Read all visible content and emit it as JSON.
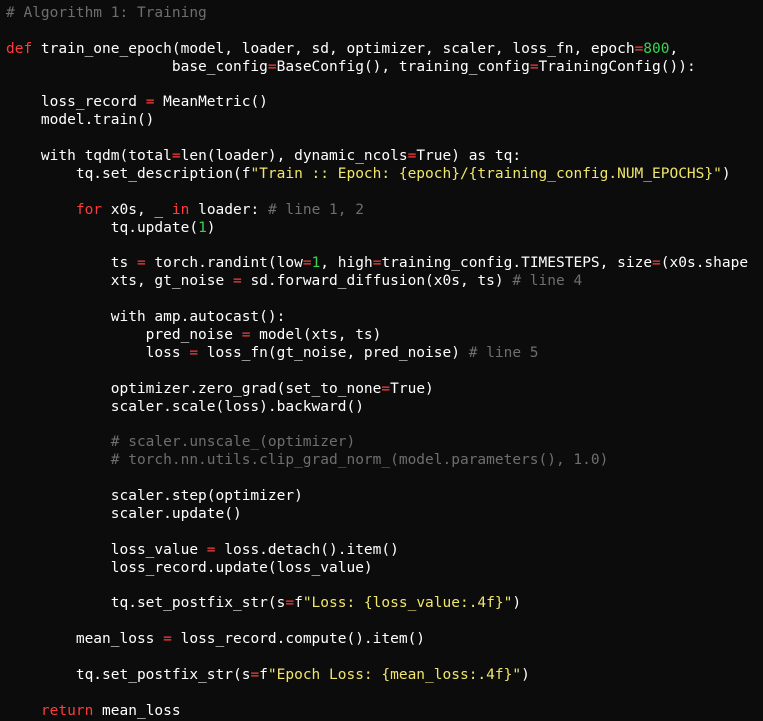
{
  "colors": {
    "background": "#0c0c0c",
    "text": "#ffffff",
    "comment": "#6e6e6e",
    "keyword": "#ff3b3b",
    "number": "#39d353",
    "string": "#f0e66b"
  },
  "code": {
    "lines": [
      [
        {
          "t": "# Algorithm 1: Training",
          "c": "comment"
        }
      ],
      [],
      [
        {
          "t": "def",
          "c": "kw"
        },
        {
          "t": " train_one_epoch(model, loader, sd, optimizer, scaler, loss_fn, epoch",
          "c": "ident"
        },
        {
          "t": "=",
          "c": "op"
        },
        {
          "t": "800",
          "c": "num"
        },
        {
          "t": ",",
          "c": "ident"
        }
      ],
      [
        {
          "t": "                   base_config",
          "c": "ident"
        },
        {
          "t": "=",
          "c": "op"
        },
        {
          "t": "BaseConfig(), training_config",
          "c": "ident"
        },
        {
          "t": "=",
          "c": "op"
        },
        {
          "t": "TrainingConfig()):",
          "c": "ident"
        }
      ],
      [],
      [
        {
          "t": "    loss_record ",
          "c": "ident"
        },
        {
          "t": "=",
          "c": "op"
        },
        {
          "t": " MeanMetric()",
          "c": "ident"
        }
      ],
      [
        {
          "t": "    model.train()",
          "c": "ident"
        }
      ],
      [],
      [
        {
          "t": "    with tqdm(total",
          "c": "ident"
        },
        {
          "t": "=",
          "c": "op"
        },
        {
          "t": "len(loader), dynamic_ncols",
          "c": "ident"
        },
        {
          "t": "=",
          "c": "op"
        },
        {
          "t": "True) as tq:",
          "c": "ident"
        }
      ],
      [
        {
          "t": "        tq.set_description(f",
          "c": "ident"
        },
        {
          "t": "\"Train :: Epoch: {epoch}/{training_config.NUM_EPOCHS}\"",
          "c": "str"
        },
        {
          "t": ")",
          "c": "ident"
        }
      ],
      [],
      [
        {
          "t": "        ",
          "c": "ident"
        },
        {
          "t": "for",
          "c": "kw"
        },
        {
          "t": " x0s, _ ",
          "c": "ident"
        },
        {
          "t": "in",
          "c": "kw"
        },
        {
          "t": " loader: ",
          "c": "ident"
        },
        {
          "t": "# line 1, 2",
          "c": "comment"
        }
      ],
      [
        {
          "t": "            tq.update(",
          "c": "ident"
        },
        {
          "t": "1",
          "c": "num"
        },
        {
          "t": ")",
          "c": "ident"
        }
      ],
      [],
      [
        {
          "t": "            ts ",
          "c": "ident"
        },
        {
          "t": "=",
          "c": "op"
        },
        {
          "t": " torch.randint(low",
          "c": "ident"
        },
        {
          "t": "=",
          "c": "op"
        },
        {
          "t": "1",
          "c": "num"
        },
        {
          "t": ", high",
          "c": "ident"
        },
        {
          "t": "=",
          "c": "op"
        },
        {
          "t": "training_config.TIMESTEPS, size",
          "c": "ident"
        },
        {
          "t": "=",
          "c": "op"
        },
        {
          "t": "(x0s.shape",
          "c": "ident"
        }
      ],
      [
        {
          "t": "            xts, gt_noise ",
          "c": "ident"
        },
        {
          "t": "=",
          "c": "op"
        },
        {
          "t": " sd.forward_diffusion(x0s, ts) ",
          "c": "ident"
        },
        {
          "t": "# line 4",
          "c": "comment"
        }
      ],
      [],
      [
        {
          "t": "            with amp.autocast():",
          "c": "ident"
        }
      ],
      [
        {
          "t": "                pred_noise ",
          "c": "ident"
        },
        {
          "t": "=",
          "c": "op"
        },
        {
          "t": " model(xts, ts)",
          "c": "ident"
        }
      ],
      [
        {
          "t": "                loss ",
          "c": "ident"
        },
        {
          "t": "=",
          "c": "op"
        },
        {
          "t": " loss_fn(gt_noise, pred_noise) ",
          "c": "ident"
        },
        {
          "t": "# line 5",
          "c": "comment"
        }
      ],
      [],
      [
        {
          "t": "            optimizer.zero_grad(set_to_none",
          "c": "ident"
        },
        {
          "t": "=",
          "c": "op"
        },
        {
          "t": "True)",
          "c": "ident"
        }
      ],
      [
        {
          "t": "            scaler.scale(loss).backward()",
          "c": "ident"
        }
      ],
      [],
      [
        {
          "t": "            # scaler.unscale_(optimizer)",
          "c": "comment"
        }
      ],
      [
        {
          "t": "            # torch.nn.utils.clip_grad_norm_(model.parameters(), 1.0)",
          "c": "comment"
        }
      ],
      [],
      [
        {
          "t": "            scaler.step(optimizer)",
          "c": "ident"
        }
      ],
      [
        {
          "t": "            scaler.update()",
          "c": "ident"
        }
      ],
      [],
      [
        {
          "t": "            loss_value ",
          "c": "ident"
        },
        {
          "t": "=",
          "c": "op"
        },
        {
          "t": " loss.detach().item()",
          "c": "ident"
        }
      ],
      [
        {
          "t": "            loss_record.update(loss_value)",
          "c": "ident"
        }
      ],
      [],
      [
        {
          "t": "            tq.set_postfix_str(s",
          "c": "ident"
        },
        {
          "t": "=",
          "c": "op"
        },
        {
          "t": "f",
          "c": "ident"
        },
        {
          "t": "\"Loss: {loss_value:.4f}\"",
          "c": "str"
        },
        {
          "t": ")",
          "c": "ident"
        }
      ],
      [],
      [
        {
          "t": "        mean_loss ",
          "c": "ident"
        },
        {
          "t": "=",
          "c": "op"
        },
        {
          "t": " loss_record.compute().item()",
          "c": "ident"
        }
      ],
      [],
      [
        {
          "t": "        tq.set_postfix_str(s",
          "c": "ident"
        },
        {
          "t": "=",
          "c": "op"
        },
        {
          "t": "f",
          "c": "ident"
        },
        {
          "t": "\"Epoch Loss: {mean_loss:.4f}\"",
          "c": "str"
        },
        {
          "t": ")",
          "c": "ident"
        }
      ],
      [],
      [
        {
          "t": "    ",
          "c": "ident"
        },
        {
          "t": "return",
          "c": "kw"
        },
        {
          "t": " mean_loss",
          "c": "ident"
        }
      ]
    ]
  }
}
